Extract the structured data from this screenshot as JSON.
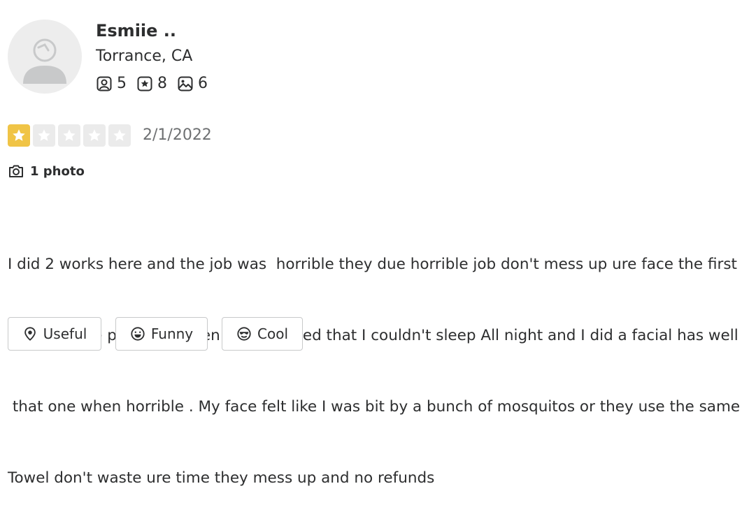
{
  "reviewer": {
    "name": "Esmiie ..",
    "location": "Torrance, CA",
    "stats": {
      "friends": "5",
      "reviews": "8",
      "photos": "6"
    }
  },
  "review": {
    "rating": 1,
    "rating_max": 5,
    "date": "2/1/2022",
    "photo_link": "1 photo",
    "lines": [
      "I did 2 works here and the job was  horrible they due horrible job don't mess up ure face the first",
      "one I did the peel that when so frustrated that I couldn't sleep All night and I did a facial has well",
      " that one when horrible . My face felt like I was bit by a bunch of mosquitos or they use the same",
      "Towel don't waste ure time they mess up and no refunds"
    ]
  },
  "reactions": {
    "useful": "Useful",
    "funny": "Funny",
    "cool": "Cool"
  },
  "colors": {
    "star_filled": "#f0c446",
    "star_empty": "#ebebeb",
    "text": "#2d2e2f",
    "muted": "#6e7072"
  }
}
